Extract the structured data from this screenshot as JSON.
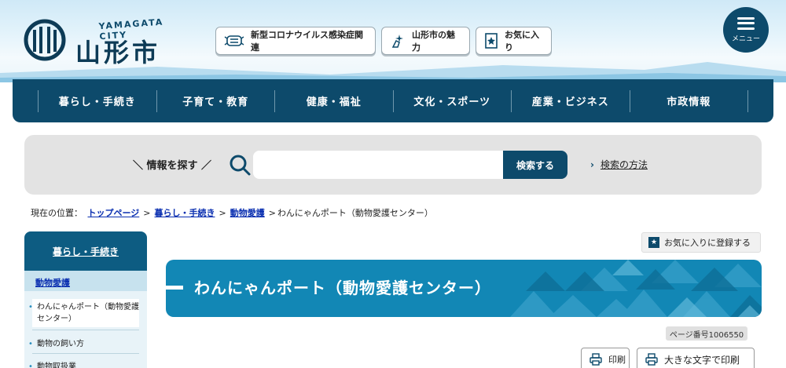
{
  "header": {
    "logo_en": "YAMAGATA CITY",
    "logo_jp": "山形市",
    "buttons": [
      {
        "label": "新型コロナウイルス感染症関連",
        "icon": "mask-icon"
      },
      {
        "label": "山形市の魅力",
        "icon": "sparkle-hand-icon"
      },
      {
        "label": "お気に入り",
        "icon": "star-bookmark-icon"
      }
    ],
    "menu_label": "メニュー"
  },
  "global_nav": [
    "暮らし・手続き",
    "子育て・教育",
    "健康・福祉",
    "文化・スポーツ",
    "産業・ビジネス",
    "市政情報"
  ],
  "search": {
    "lead": "＼ 情報を探す ／",
    "placeholder": "",
    "button": "検索する",
    "how_arrow": "›",
    "how_label": "検索の方法"
  },
  "breadcrumb": {
    "prefix": "現在の位置：",
    "links": [
      "トップページ",
      "暮らし・手続き",
      "動物愛護"
    ],
    "current": "わんにゃんポート（動物愛護センター）"
  },
  "sidebar": {
    "heading": "暮らし・手続き",
    "category": "動物愛護",
    "items": [
      "わんにゃんポート（動物愛護センター）",
      "動物の飼い方",
      "動物取扱業"
    ]
  },
  "content": {
    "fav_button": "お気に入りに登録する",
    "title": "わんにゃんポート（動物愛護センター）",
    "page_number": "ページ番号1006550",
    "print": "印刷",
    "print_large": "大きな文字で印刷"
  },
  "colors": {
    "brand": "#0d4a6b",
    "banner": "#1287b5",
    "link": "#0a2fb0"
  }
}
